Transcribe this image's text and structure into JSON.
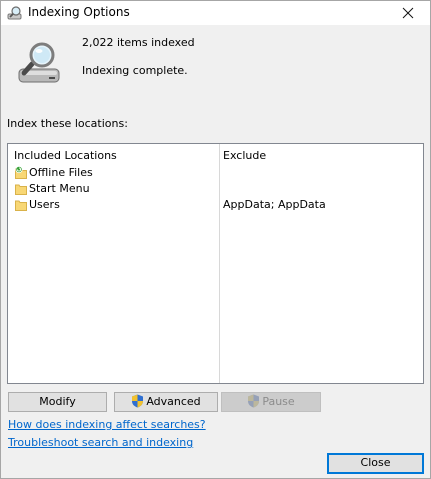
{
  "window": {
    "title": "Indexing Options",
    "title_icon": "indexing-options-icon",
    "close_icon": "close-icon"
  },
  "status": {
    "icon": "drive-magnifier-icon",
    "items_indexed": "2,022 items indexed",
    "message": "Indexing complete."
  },
  "locations": {
    "label": "Index these locations:",
    "columns": {
      "included": "Included Locations",
      "exclude": "Exclude"
    },
    "rows": [
      {
        "name": "Offline Files",
        "exclude": "",
        "icon": "offline-folder-icon"
      },
      {
        "name": "Start Menu",
        "exclude": "",
        "icon": "folder-icon"
      },
      {
        "name": "Users",
        "exclude": "AppData; AppData",
        "icon": "folder-icon"
      }
    ]
  },
  "buttons": {
    "modify": "Modify",
    "advanced": "Advanced",
    "pause": "Pause",
    "close": "Close"
  },
  "links": {
    "how_affect": "How does indexing affect searches?",
    "troubleshoot": "Troubleshoot search and indexing"
  },
  "colors": {
    "window_bg": "#f0f0f0",
    "link": "#0066cc",
    "focus_border": "#0078d7",
    "folder": "#f8d775"
  }
}
